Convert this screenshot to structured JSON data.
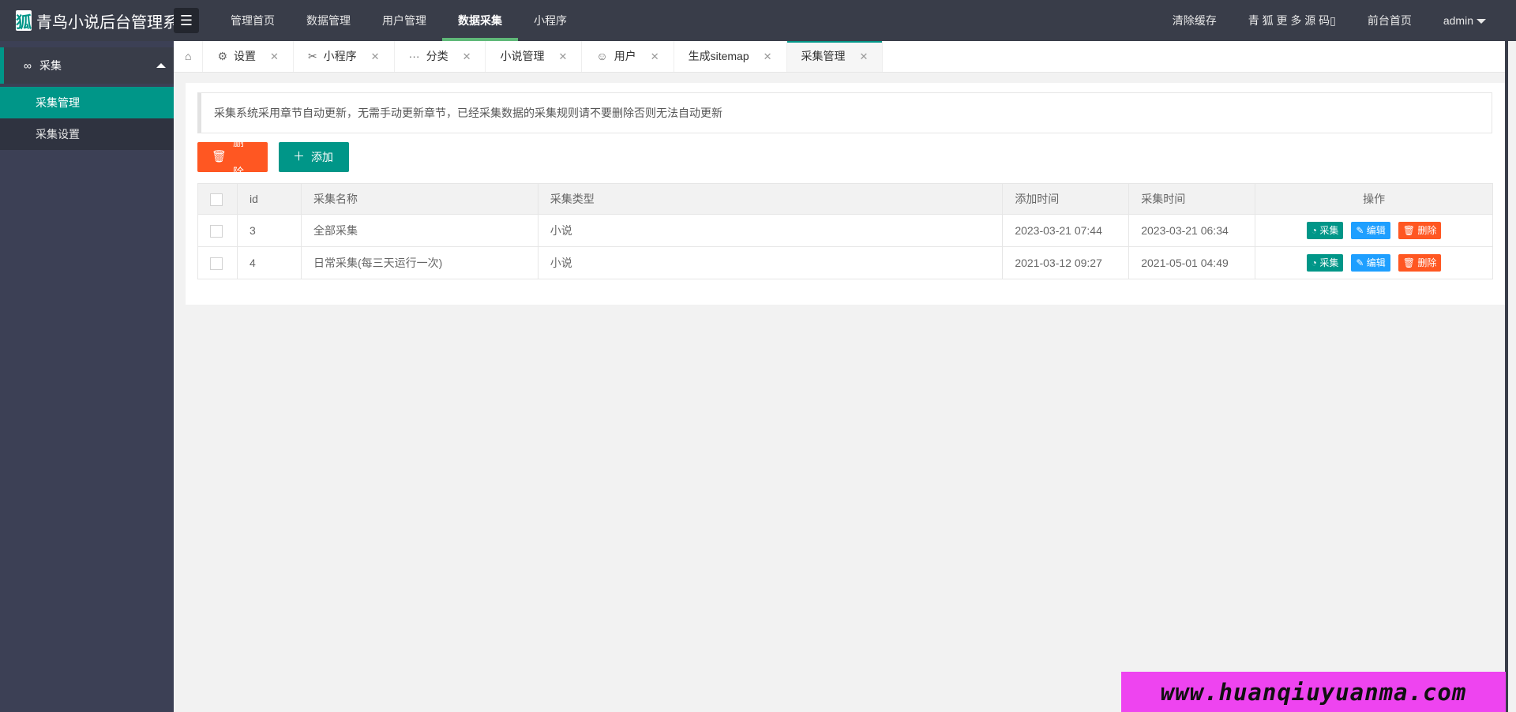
{
  "app": {
    "title": "青鸟小说后台管理系",
    "logo_char": "狐"
  },
  "topnav": {
    "fold_icon": "fold-menu-icon",
    "items": [
      {
        "label": "管理首页"
      },
      {
        "label": "数据管理"
      },
      {
        "label": "用户管理"
      },
      {
        "label": "数据采集",
        "active": true
      },
      {
        "label": "小程序"
      }
    ],
    "right": [
      {
        "label": "清除缓存"
      },
      {
        "label": "青 狐 更 多 源 码▯"
      },
      {
        "label": "前台首页"
      },
      {
        "label": "admin"
      }
    ]
  },
  "sidebar": {
    "group": {
      "label": "采集",
      "icon": "link-icon"
    },
    "items": [
      {
        "label": "采集管理",
        "active": true
      },
      {
        "label": "采集设置"
      }
    ]
  },
  "tabs": [
    {
      "label": "设置",
      "icon": "gear-icon"
    },
    {
      "label": "小程序",
      "icon": "tools-icon"
    },
    {
      "label": "分类",
      "icon": "more-icon"
    },
    {
      "label": "小说管理",
      "icon": ""
    },
    {
      "label": "用户",
      "icon": "user-icon"
    },
    {
      "label": "生成sitemap",
      "icon": ""
    },
    {
      "label": "采集管理",
      "icon": "",
      "active": true
    }
  ],
  "notice": "采集系统采用章节自动更新，无需手动更新章节，已经采集数据的采集规则请不要删除否则无法自动更新",
  "toolbar": {
    "delete_label": "删除",
    "add_label": "添加"
  },
  "table": {
    "headers": [
      "id",
      "采集名称",
      "采集类型",
      "添加时间",
      "采集时间",
      "操作"
    ],
    "rows": [
      {
        "id": "3",
        "name": "全部采集",
        "type": "小说",
        "added": "2023-03-21 07:44",
        "collected": "2023-03-21 06:34"
      },
      {
        "id": "4",
        "name": "日常采集(每三天运行一次)",
        "type": "小说",
        "added": "2021-03-12 09:27",
        "collected": "2021-05-01 04:49"
      }
    ],
    "actions": {
      "collect": "采集",
      "edit": "编辑",
      "delete": "删除"
    }
  },
  "watermark": "www.huanqiuyuanma.com",
  "colors": {
    "accent": "#009688",
    "danger": "#ff5722",
    "info": "#1e9fff",
    "topbar": "#393d49"
  }
}
